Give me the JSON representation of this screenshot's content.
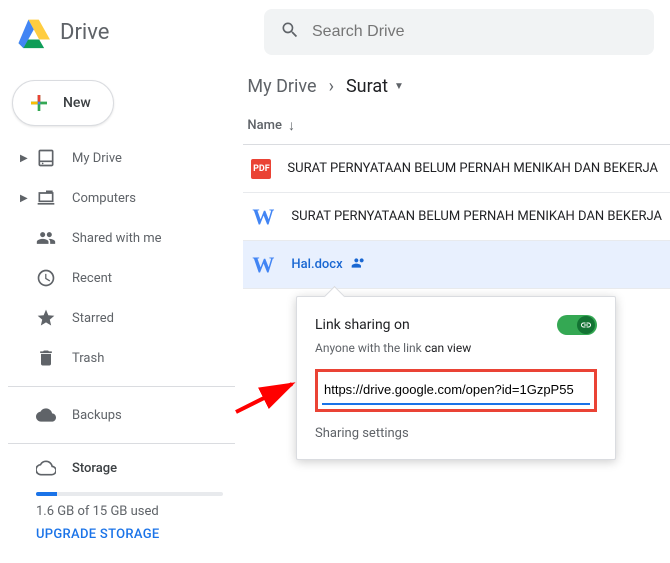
{
  "header": {
    "app_name": "Drive",
    "search_placeholder": "Search Drive"
  },
  "sidebar": {
    "new_button": "New",
    "items": [
      {
        "label": "My Drive",
        "icon": "drive",
        "expandable": true
      },
      {
        "label": "Computers",
        "icon": "computers",
        "expandable": true
      },
      {
        "label": "Shared with me",
        "icon": "shared",
        "expandable": false
      },
      {
        "label": "Recent",
        "icon": "recent",
        "expandable": false
      },
      {
        "label": "Starred",
        "icon": "star",
        "expandable": false
      },
      {
        "label": "Trash",
        "icon": "trash",
        "expandable": false
      }
    ],
    "backups": "Backups",
    "storage": {
      "title": "Storage",
      "used_text": "1.6 GB of 15 GB used",
      "percent": 11,
      "upgrade_label": "UPGRADE STORAGE"
    }
  },
  "breadcrumb": {
    "root": "My Drive",
    "current": "Surat"
  },
  "columns": {
    "name": "Name"
  },
  "files": [
    {
      "type": "pdf",
      "name": "SURAT PERNYATAAN BELUM PERNAH MENIKAH DAN BEKERJA",
      "selected": false,
      "shared": false
    },
    {
      "type": "docx",
      "name": "SURAT PERNYATAAN BELUM PERNAH MENIKAH DAN BEKERJA",
      "selected": false,
      "shared": false
    },
    {
      "type": "docx",
      "name": "Hal.docx",
      "selected": true,
      "shared": true
    }
  ],
  "popup": {
    "title": "Link sharing on",
    "subtitle_prefix": "Anyone with the link ",
    "permission": "can view",
    "link_url": "https://drive.google.com/open?id=1GzpP55",
    "settings_label": "Sharing settings"
  },
  "icons": {
    "pdf_label": "PDF",
    "docx_label": "W"
  }
}
